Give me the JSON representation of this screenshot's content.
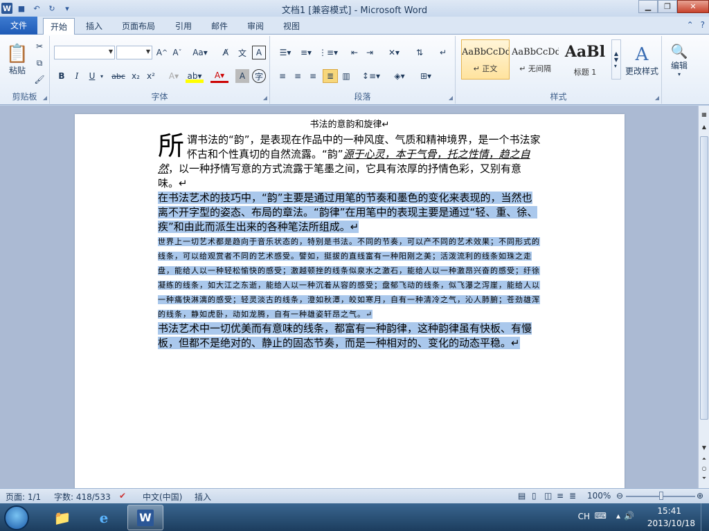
{
  "app": {
    "window_title": "文档1 [兼容模式] - Microsoft Word"
  },
  "ribbon_tabs": [
    "文件",
    "开始",
    "插入",
    "页面布局",
    "引用",
    "邮件",
    "审阅",
    "视图"
  ],
  "ribbon": {
    "clipboard": {
      "paste_label": "粘贴",
      "group_label": "剪贴板"
    },
    "font": {
      "font_name": "",
      "font_size": "",
      "group_label": "字体",
      "bold": "B",
      "italic": "I",
      "underline": "U",
      "strike": "abc",
      "subscript": "x₂",
      "superscript": "x²"
    },
    "paragraph": {
      "group_label": "段落"
    },
    "styles": {
      "group_label": "样式",
      "items": [
        {
          "sample": "AaBbCcDd",
          "name": "↵ 正文"
        },
        {
          "sample": "AaBbCcDd",
          "name": "↵ 无间隔"
        },
        {
          "sample": "AaBl",
          "name": "标题 1"
        }
      ],
      "change_styles_label": "更改样式"
    },
    "editing": {
      "label": "编辑"
    }
  },
  "document": {
    "title_line": "书法的意韵和旋律↵",
    "p1_dropcap": "所",
    "p1_text_a": "谓书法的“韵”，是表现在作品中的一种风度、气质和精神境界，是一个书法家怀古和个性真切的自然流露。“韵”",
    "p1_italic": "源于心灵，本于气骨，托之性情，趋之自然",
    "p1_text_b": "，以一种抒情写意的方式流露于笔墨之间，它具有浓厚的抒情色彩，又别有意味。↵",
    "p2": "在书法艺术的技巧中，“韵”主要是通过用笔的节奏和墨色的变化来表现的，当然也离不开字型的姿态、布局的章法。“韵律”在用笔中的表现主要是通过“轻、重、徐、疾”和由此而派生出来的各种笔法所组成。↵",
    "p3": "世界上一切艺术都是趋向于音乐状态的，特别是书法。不同的节奏，可以产不同的艺术效果；不同形式的线条，可以给观赏者不同的艺术感受。譬如，挺拔的直线富有一种阳刚之美；活泼流利的线条如珠之走盘，能给人以一种轻松愉快的感受；激越顿挫的线条似泉水之激石，能给人以一种激昂兴奋的感受；纡徐凝练的线条，如大江之东逝，能给人以一种沉着从容的感受；盘郁飞动的线条，似飞瀑之泻崖，能给人以一种痛快淋漓的感受；轻灵淡古的线条，澄如秋潭，皎如寒月，自有一种清冷之气，沁人肺腑；苍劲雄浑的线条，静如虎卧，动如龙腾，自有一种雄姿轩昂之气。↵",
    "p4": "书法艺术中一切优美而有意味的线条，都富有一种韵律，这种韵律虽有快板、有慢板，但都不是绝对的、静止的固态节奏，而是一种相对的、变化的动态平稳。↵"
  },
  "status_bar": {
    "page": "页面: 1/1",
    "word_count": "字数: 418/533",
    "language": "中文(中国)",
    "mode": "插入",
    "zoom": "100%"
  },
  "taskbar": {
    "ime": "CH",
    "time": "15:41",
    "date": "2013/10/18"
  }
}
